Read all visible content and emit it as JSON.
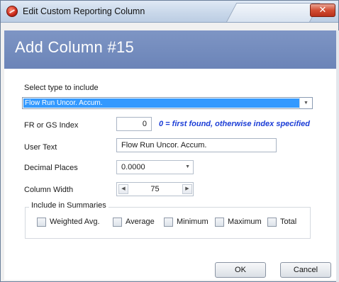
{
  "window": {
    "title": "Edit Custom Reporting Column",
    "close_glyph": "✕"
  },
  "banner": {
    "heading": "Add Column #15"
  },
  "form": {
    "type_label": "Select type to include",
    "type_selected": "Flow Run Uncor. Accum.",
    "index_label": "FR or GS Index",
    "index_value": "0",
    "index_hint": "0 = first found, otherwise index specified",
    "user_text_label": "User Text",
    "user_text_value": "Flow Run Uncor. Accum.",
    "decimal_label": "Decimal Places",
    "decimal_value": "0.0000",
    "width_label": "Column Width",
    "width_value": "75"
  },
  "summaries": {
    "group_label": "Include in Summaries",
    "options": [
      {
        "label": "Weighted Avg.",
        "checked": false
      },
      {
        "label": "Average",
        "checked": false
      },
      {
        "label": "Minimum",
        "checked": false
      },
      {
        "label": "Maximum",
        "checked": false
      },
      {
        "label": "Total",
        "checked": false
      }
    ]
  },
  "buttons": {
    "ok": "OK",
    "cancel": "Cancel"
  },
  "icons": {
    "app": "app-logo-icon",
    "dropdown": "chevron-down-icon",
    "spin_left": "chevron-left-icon",
    "spin_right": "chevron-right-icon",
    "close": "close-icon"
  },
  "colors": {
    "banner": "#6b84b8",
    "selection": "#3399ff",
    "hint": "#1a3cd6",
    "close_button": "#d24d33"
  }
}
